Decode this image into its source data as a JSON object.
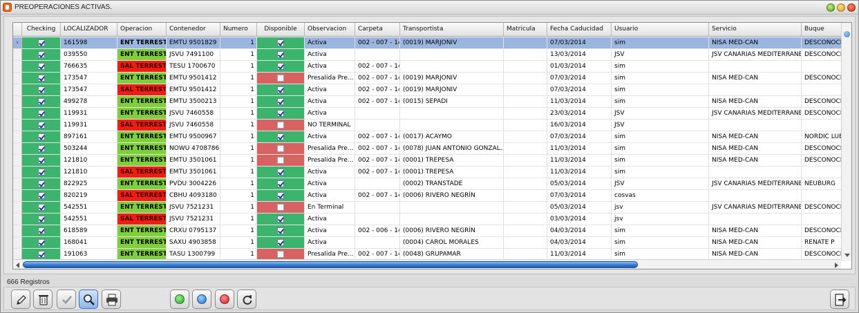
{
  "window": {
    "title": "PREOPERACIONES ACTIVAS."
  },
  "colors": {
    "green": "#3db46d",
    "red": "#d86161",
    "ent": "#7fcf3c",
    "sal": "#f01d12",
    "selected": "#9bb5e0"
  },
  "grid": {
    "columns": [
      "Checking",
      "LOCALIZADOR",
      "Operacion",
      "Contenedor",
      "Numero",
      "Disponible",
      "Observacion",
      "Carpeta",
      "Transportista",
      "Matricula",
      "Fecha Caducidad",
      "Usuario",
      "Servicio",
      "Buque"
    ],
    "row_indicator": "›",
    "rows": [
      {
        "checking": true,
        "localizador": "161598",
        "operacion": "ENT TERRESTRE",
        "contenedor": "EMTU 9501829",
        "numero": "1",
        "disponible": true,
        "observacion": "Activa",
        "carpeta": "002 - 007 - 14",
        "transportista": "(0019) MARJONIV",
        "matricula": "",
        "fecha": "07/03/2014",
        "usuario": "sim",
        "servicio": "NISA MED-CAN",
        "buque": "DESCONOCIDO",
        "selected": true
      },
      {
        "checking": true,
        "localizador": "039550",
        "operacion": "ENT TERRESTRE",
        "contenedor": "JSVU 7491100",
        "numero": "1",
        "disponible": true,
        "observacion": "Activa",
        "carpeta": "",
        "transportista": "",
        "matricula": "",
        "fecha": "13/03/2014",
        "usuario": "JSV",
        "servicio": "JSV CANARIAS MEDITERRANEO",
        "buque": "DESCONOCIDO"
      },
      {
        "checking": true,
        "localizador": "766635",
        "operacion": "SAL TERRESTRE",
        "contenedor": "TESU 1700670",
        "numero": "1",
        "disponible": true,
        "observacion": "Activa",
        "carpeta": "002 - 007 - 14",
        "transportista": "",
        "matricula": "",
        "fecha": "01/03/2014",
        "usuario": "sim",
        "servicio": "",
        "buque": ""
      },
      {
        "checking": true,
        "localizador": "173547",
        "operacion": "ENT TERRESTRE",
        "contenedor": "EMTU 9501412",
        "numero": "1",
        "disponible": false,
        "observacion": "Presalida Pre...",
        "carpeta": "002 - 007 - 14",
        "transportista": "(0019) MARJONIV",
        "matricula": "",
        "fecha": "07/03/2014",
        "usuario": "sim",
        "servicio": "NISA MED-CAN",
        "buque": "DESCONOCIDO"
      },
      {
        "checking": true,
        "localizador": "173547",
        "operacion": "SAL TERRESTRE",
        "contenedor": "EMTU 9501412",
        "numero": "1",
        "disponible": true,
        "observacion": "Activa",
        "carpeta": "002 - 007 - 14",
        "transportista": "(0019) MARJONIV",
        "matricula": "",
        "fecha": "07/03/2014",
        "usuario": "sim",
        "servicio": "",
        "buque": ""
      },
      {
        "checking": true,
        "localizador": "499278",
        "operacion": "ENT TERRESTRE",
        "contenedor": "EMTU 3500213",
        "numero": "1",
        "disponible": true,
        "observacion": "Activa",
        "carpeta": "002 - 007 - 14",
        "transportista": "(0015) SEPADI",
        "matricula": "",
        "fecha": "11/03/2014",
        "usuario": "sim",
        "servicio": "NISA MED-CAN",
        "buque": "DESCONOCIDO"
      },
      {
        "checking": true,
        "localizador": "119931",
        "operacion": "ENT TERRESTRE",
        "contenedor": "JSVU 7460558",
        "numero": "1",
        "disponible": true,
        "observacion": "Activa",
        "carpeta": "",
        "transportista": "",
        "matricula": "",
        "fecha": "23/03/2014",
        "usuario": "JSV",
        "servicio": "JSV CANARIAS MEDITERRANEO",
        "buque": "DESCONOCIDO"
      },
      {
        "checking": true,
        "localizador": "119931",
        "operacion": "SAL TERRESTRE",
        "contenedor": "JSVU 7460558",
        "numero": "1",
        "disponible": false,
        "observacion": "NO TERMINAL",
        "carpeta": "",
        "transportista": "",
        "matricula": "",
        "fecha": "16/03/2014",
        "usuario": "JSV",
        "servicio": "",
        "buque": ""
      },
      {
        "checking": true,
        "localizador": "897161",
        "operacion": "ENT TERRESTRE",
        "contenedor": "EMTU 9500967",
        "numero": "1",
        "disponible": true,
        "observacion": "Activa",
        "carpeta": "002 - 007 - 14",
        "transportista": "(0017) ACAYMO",
        "matricula": "",
        "fecha": "07/03/2014",
        "usuario": "sim",
        "servicio": "NISA MED-CAN",
        "buque": "NORDIC LUEB..."
      },
      {
        "checking": true,
        "localizador": "503244",
        "operacion": "ENT TERRESTRE",
        "contenedor": "NOWU 4708786",
        "numero": "1",
        "disponible": false,
        "observacion": "Presalida Pre...",
        "carpeta": "002 - 007 - 14",
        "transportista": "(0078) JUAN ANTONIO GONZAL...",
        "matricula": "",
        "fecha": "11/03/2014",
        "usuario": "sim",
        "servicio": "NISA MED-CAN",
        "buque": "DESCONOCIDO"
      },
      {
        "checking": true,
        "localizador": "121810",
        "operacion": "ENT TERRESTRE",
        "contenedor": "EMTU 3501061",
        "numero": "1",
        "disponible": false,
        "observacion": "Presalida Pre...",
        "carpeta": "002 - 007 - 14",
        "transportista": "(0001) TREPESA",
        "matricula": "",
        "fecha": "11/03/2014",
        "usuario": "sim",
        "servicio": "NISA MED-CAN",
        "buque": "DESCONOCIDO"
      },
      {
        "checking": true,
        "localizador": "121810",
        "operacion": "SAL TERRESTRE",
        "contenedor": "EMTU 3501061",
        "numero": "1",
        "disponible": true,
        "observacion": "Activa",
        "carpeta": "002 - 007 - 14",
        "transportista": "(0001) TREPESA",
        "matricula": "",
        "fecha": "11/03/2014",
        "usuario": "sim",
        "servicio": "",
        "buque": ""
      },
      {
        "checking": true,
        "localizador": "822925",
        "operacion": "ENT TERRESTRE",
        "contenedor": "PVDU 3004226",
        "numero": "1",
        "disponible": true,
        "observacion": "Activa",
        "carpeta": "",
        "transportista": "(0002) TRANSTADE",
        "matricula": "",
        "fecha": "05/03/2014",
        "usuario": "JSV",
        "servicio": "JSV CANARIAS MEDITERRANEO",
        "buque": "NEUBURG"
      },
      {
        "checking": true,
        "localizador": "820219",
        "operacion": "SAL TERRESTRE",
        "contenedor": "CBHU 4093180",
        "numero": "1",
        "disponible": true,
        "observacion": "Activa",
        "carpeta": "002 - 007 - 14",
        "transportista": "(0006) RIVERO NEGRÍN",
        "matricula": "",
        "fecha": "07/03/2014",
        "usuario": "cosvas",
        "servicio": "",
        "buque": ""
      },
      {
        "checking": true,
        "localizador": "542551",
        "operacion": "ENT TERRESTRE",
        "contenedor": "JSVU 7521231",
        "numero": "1",
        "disponible": false,
        "observacion": "En Terminal",
        "carpeta": "",
        "transportista": "",
        "matricula": "",
        "fecha": "05/03/2014",
        "usuario": "jsv",
        "servicio": "JSV CANARIAS MEDITERRANEO",
        "buque": "DESCONOCIDO"
      },
      {
        "checking": true,
        "localizador": "542551",
        "operacion": "SAL TERRESTRE",
        "contenedor": "JSVU 7521231",
        "numero": "1",
        "disponible": true,
        "observacion": "Activa",
        "carpeta": "",
        "transportista": "",
        "matricula": "",
        "fecha": "03/03/2014",
        "usuario": "jsv",
        "servicio": "",
        "buque": ""
      },
      {
        "checking": true,
        "localizador": "618589",
        "operacion": "ENT TERRESTRE",
        "contenedor": "CRXU 0795137",
        "numero": "1",
        "disponible": true,
        "observacion": "Activa",
        "carpeta": "002 - 006 - 14",
        "transportista": "(0006) RIVERO NEGRÍN",
        "matricula": "",
        "fecha": "04/03/2014",
        "usuario": "sim",
        "servicio": "NISA MED-CAN",
        "buque": "DESCONOCIDO"
      },
      {
        "checking": true,
        "localizador": "168041",
        "operacion": "ENT TERRESTRE",
        "contenedor": "SAXU 4903858",
        "numero": "1",
        "disponible": true,
        "observacion": "Activa",
        "carpeta": "",
        "transportista": "(0004) CAROL MORALES",
        "matricula": "",
        "fecha": "04/03/2014",
        "usuario": "sim",
        "servicio": "NISA MED-CAN",
        "buque": "RENATE P"
      },
      {
        "checking": true,
        "localizador": "191063",
        "operacion": "ENT TERRESTRE",
        "contenedor": "TASU 1300799",
        "numero": "1",
        "disponible": false,
        "observacion": "Presalida Pre...",
        "carpeta": "002 - 007 - 14",
        "transportista": "(0048) GRUPAMAR",
        "matricula": "",
        "fecha": "11/03/2014",
        "usuario": "sim",
        "servicio": "NISA MED-CAN",
        "buque": "DESCONOCIDO"
      }
    ]
  },
  "status": {
    "records": "666 Registros"
  },
  "toolbar": {
    "buttons": [
      "edit-icon",
      "trash-icon",
      "check-icon",
      "search-icon",
      "print-icon",
      "green-filter-icon",
      "blue-filter-icon",
      "red-filter-icon",
      "refresh-icon",
      "exit-icon"
    ]
  }
}
